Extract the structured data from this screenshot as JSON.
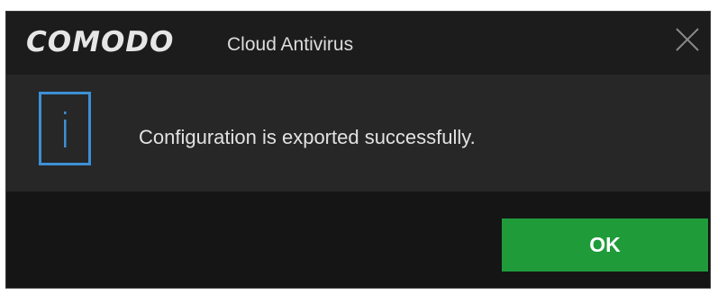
{
  "dialog": {
    "brand_text": "COMODO",
    "product_name": "Cloud Antivirus",
    "close_icon": "close-icon",
    "info_icon": "info-icon",
    "message": "Configuration is exported successfully.",
    "ok_label": "OK"
  },
  "colors": {
    "title_background": "#1c1c1c",
    "content_background": "#272727",
    "footer_background": "#151515",
    "info_icon_accent": "#3d8fd6",
    "ok_button": "#1f9b3a",
    "text": "#e2e2e2"
  }
}
